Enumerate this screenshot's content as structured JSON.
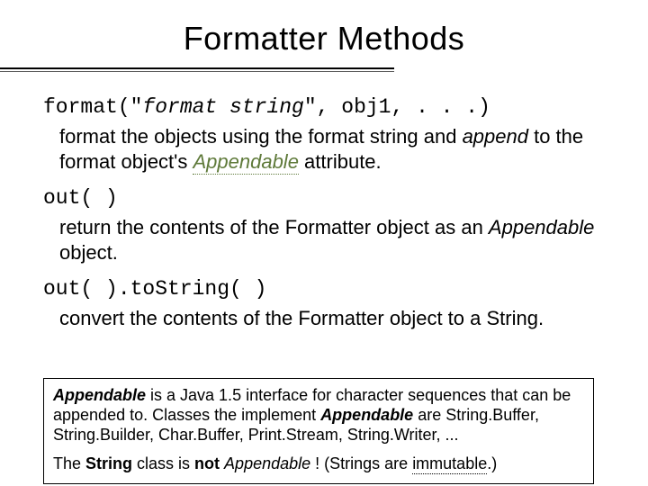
{
  "title": "Formatter Methods",
  "item1": {
    "sig_prefix": "format(\"",
    "sig_italic": "format string",
    "sig_suffix": "\", obj1, . . .)",
    "desc_a": "format the objects using the format string and ",
    "desc_append": "append",
    "desc_b": " to the format object's ",
    "desc_appendable": "Appendable",
    "desc_c": " attribute."
  },
  "item2": {
    "sig": "out( )",
    "desc_a": "return the contents of the Formatter object as an ",
    "desc_appendable": "Appendable",
    "desc_b": " object."
  },
  "item3": {
    "sig": "out( ).toString( )",
    "desc": "convert the contents of the Formatter object to a String."
  },
  "note": {
    "p1_a": "Appendable",
    "p1_b": " is a Java 1.5 interface for character sequences that can be appended to.  Classes the implement ",
    "p1_c": "Appendable",
    "p1_d": " are String.Buffer, String.Builder, Char.Buffer, Print.Stream, String.Writer, ...",
    "p2_a": "The ",
    "p2_b": "String",
    "p2_c": " class is ",
    "p2_d": "not",
    "p2_e": " ",
    "p2_f": "Appendable",
    "p2_g": " !  (Strings are ",
    "p2_h": "immutable",
    "p2_i": ".)"
  }
}
